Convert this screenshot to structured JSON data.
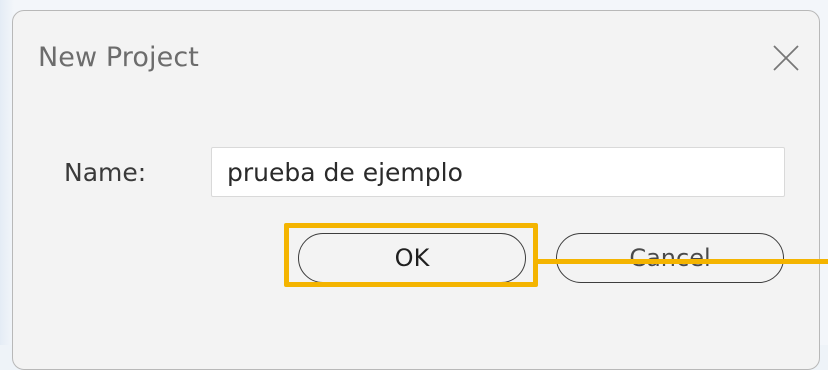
{
  "dialog": {
    "title": "New Project",
    "close_icon": "close-icon"
  },
  "form": {
    "name_label": "Name:",
    "name_value": "prueba de ejemplo"
  },
  "buttons": {
    "ok_label": "OK",
    "cancel_label": "Cancel"
  },
  "annotation": {
    "highlight_color": "#f4b400",
    "highlighted_target": "ok-button"
  }
}
